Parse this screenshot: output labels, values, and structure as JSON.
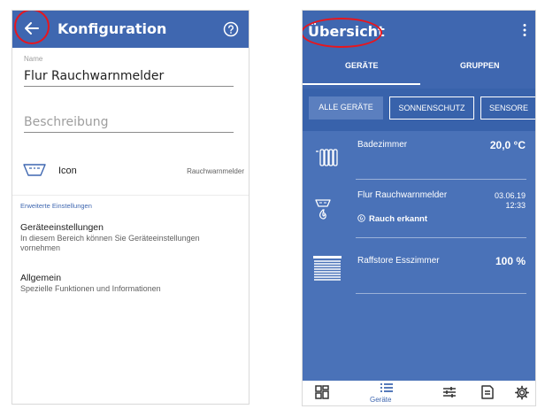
{
  "left_screen": {
    "title": "Konfiguration",
    "name_label": "Name",
    "name_value": "Flur Rauchwarnmelder",
    "description_placeholder": "Beschreibung",
    "icon_label": "Icon",
    "icon_value": "Rauchwarnmelder",
    "advanced_settings_link": "Erweiterte Einstellungen",
    "sections": [
      {
        "title": "Geräteeinstellungen",
        "subtitle": "In diesem Bereich können Sie Geräteeinstellungen vornehmen"
      },
      {
        "title": "Allgemein",
        "subtitle": "Spezielle Funktionen und Informationen"
      }
    ]
  },
  "right_screen": {
    "title": "Übersicht",
    "tabs": [
      {
        "label": "GERÄTE",
        "active": true
      },
      {
        "label": "GRUPPEN",
        "active": false
      }
    ],
    "filter_chips": [
      {
        "label": "ALLE GERÄTE",
        "selected": true
      },
      {
        "label": "SONNENSCHUTZ",
        "selected": false
      },
      {
        "label": "SENSORE",
        "selected": false
      }
    ],
    "devices": [
      {
        "name": "Badezimmer",
        "value": "20,0 °C",
        "icon": "radiator-icon"
      },
      {
        "name": "Flur Rauchwarnmelder",
        "date": "03.06.19",
        "time": "12:33",
        "alert": "Rauch erkannt",
        "icon": "smoke-detector-icon"
      },
      {
        "name": "Raffstore Esszimmer",
        "value": "100 %",
        "icon": "blinds-icon"
      }
    ],
    "bottom_nav": [
      {
        "icon": "dashboard-icon",
        "active": false
      },
      {
        "icon": "device-list-icon",
        "label": "Geräte",
        "active": true
      },
      {
        "icon": "sliders-icon",
        "active": false
      },
      {
        "icon": "document-icon",
        "active": false
      },
      {
        "icon": "gear-icon",
        "active": false
      }
    ]
  },
  "colors": {
    "primary_blue": "#3f67b0",
    "list_blue": "#4a72b8",
    "highlight_red": "#e8161d"
  }
}
